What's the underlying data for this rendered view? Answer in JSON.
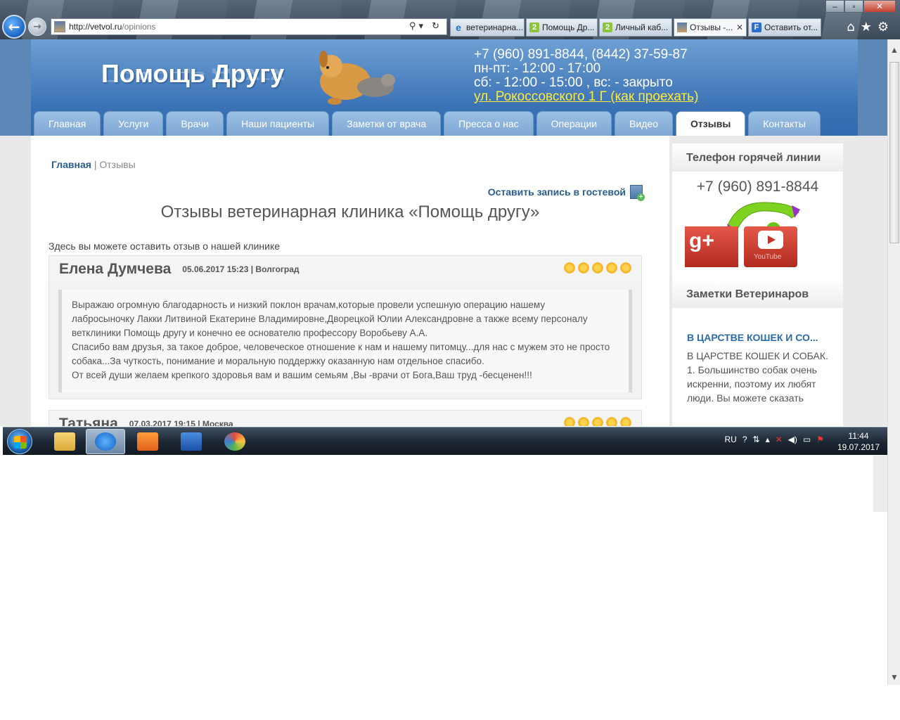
{
  "browser": {
    "url_host": "http://vetvol.ru",
    "url_path": "/opinions",
    "tabs": [
      {
        "label": "ветеринарна...",
        "icon": "ie-icon"
      },
      {
        "label": "Помощь Др...",
        "icon": "green-2-icon"
      },
      {
        "label": "Личный каб...",
        "icon": "green-2-icon"
      },
      {
        "label": "Отзывы -...",
        "icon": "site-icon",
        "active": true
      },
      {
        "label": "Оставить от...",
        "icon": "form-icon"
      }
    ],
    "addr_tools": "⚲▾ ↻",
    "right_icons": "⌂★⚙"
  },
  "site": {
    "logo": "Помощь Другу",
    "phone_line": "+7 (960) 891-8844, (8442) 37-59-87",
    "hours_weekday": "пн-пт: - 12:00 - 17:00",
    "hours_weekend": "сб: - 12:00 - 15:00 , вс: - закрыто",
    "address": "ул. Рокоссовского 1 Г (как проехать)",
    "menu": [
      "Главная",
      "Услуги",
      "Врачи",
      "Наши пациенты",
      "Заметки от врача",
      "Пресса о нас",
      "Операции",
      "Видео",
      "Отзывы",
      "Контакты"
    ],
    "menu_active_index": 8
  },
  "content": {
    "breadcrumb_home": "Главная",
    "breadcrumb_sep": " | ",
    "breadcrumb_current": "Отзывы",
    "guest_link": "Оставить запись в гостевой",
    "title": "Отзывы ветеринарная клиника «Помощь другу»",
    "intro": "Здесь вы можете оставить отзыв о нашей клинике",
    "reviews": [
      {
        "author": "Елена Думчева",
        "meta": "05.06.2017 15:23 | Волгоград",
        "stars": 5,
        "lines": [
          "Выражаю огромную благодарность и низкий поклон врачам,которые провели успешную операцию нашему",
          "лабросыночку Лакки Литвиной Екатерине Владимировне,Дворецкой Юлии Александровне а также всему персоналу",
          "ветклиники Помощь другу и конечно ее основателю профессору Воробьеву А.А.",
          "Спасибо вам друзья, за такое доброе, человеческое отношение к нам и нашему питомцу...для нас с мужем это не просто",
          "собака...За чуткость, понимание и моральную поддержку оказанную нам отдельное спасибо.",
          "От всей души желаем крепкого здоровья вам и вашим семьям ,Вы -врачи от Бога,Ваш труд -бесценен!!!"
        ]
      },
      {
        "author": "Татьяна",
        "meta": "07.03.2017 19:15 | Москва",
        "stars": 5
      }
    ]
  },
  "sidebar": {
    "hotline_title": "Телефон горячей линии",
    "hotline_phone": "+7 (960) 891-8844",
    "youtube_label": "YouTube",
    "gplus_label": "g+",
    "notes_title": "Заметки Ветеринаров",
    "note_link": "В ЦАРСТВЕ КОШЕК И СО...",
    "note_text": "В ЦАРСТВЕ КОШЕК И СОБАК. 1. Большинство собак очень искренни, поэтому их любят люди. Вы можете сказать"
  },
  "taskbar": {
    "lang": "RU",
    "time": "11:44",
    "date": "19.07.2017"
  }
}
